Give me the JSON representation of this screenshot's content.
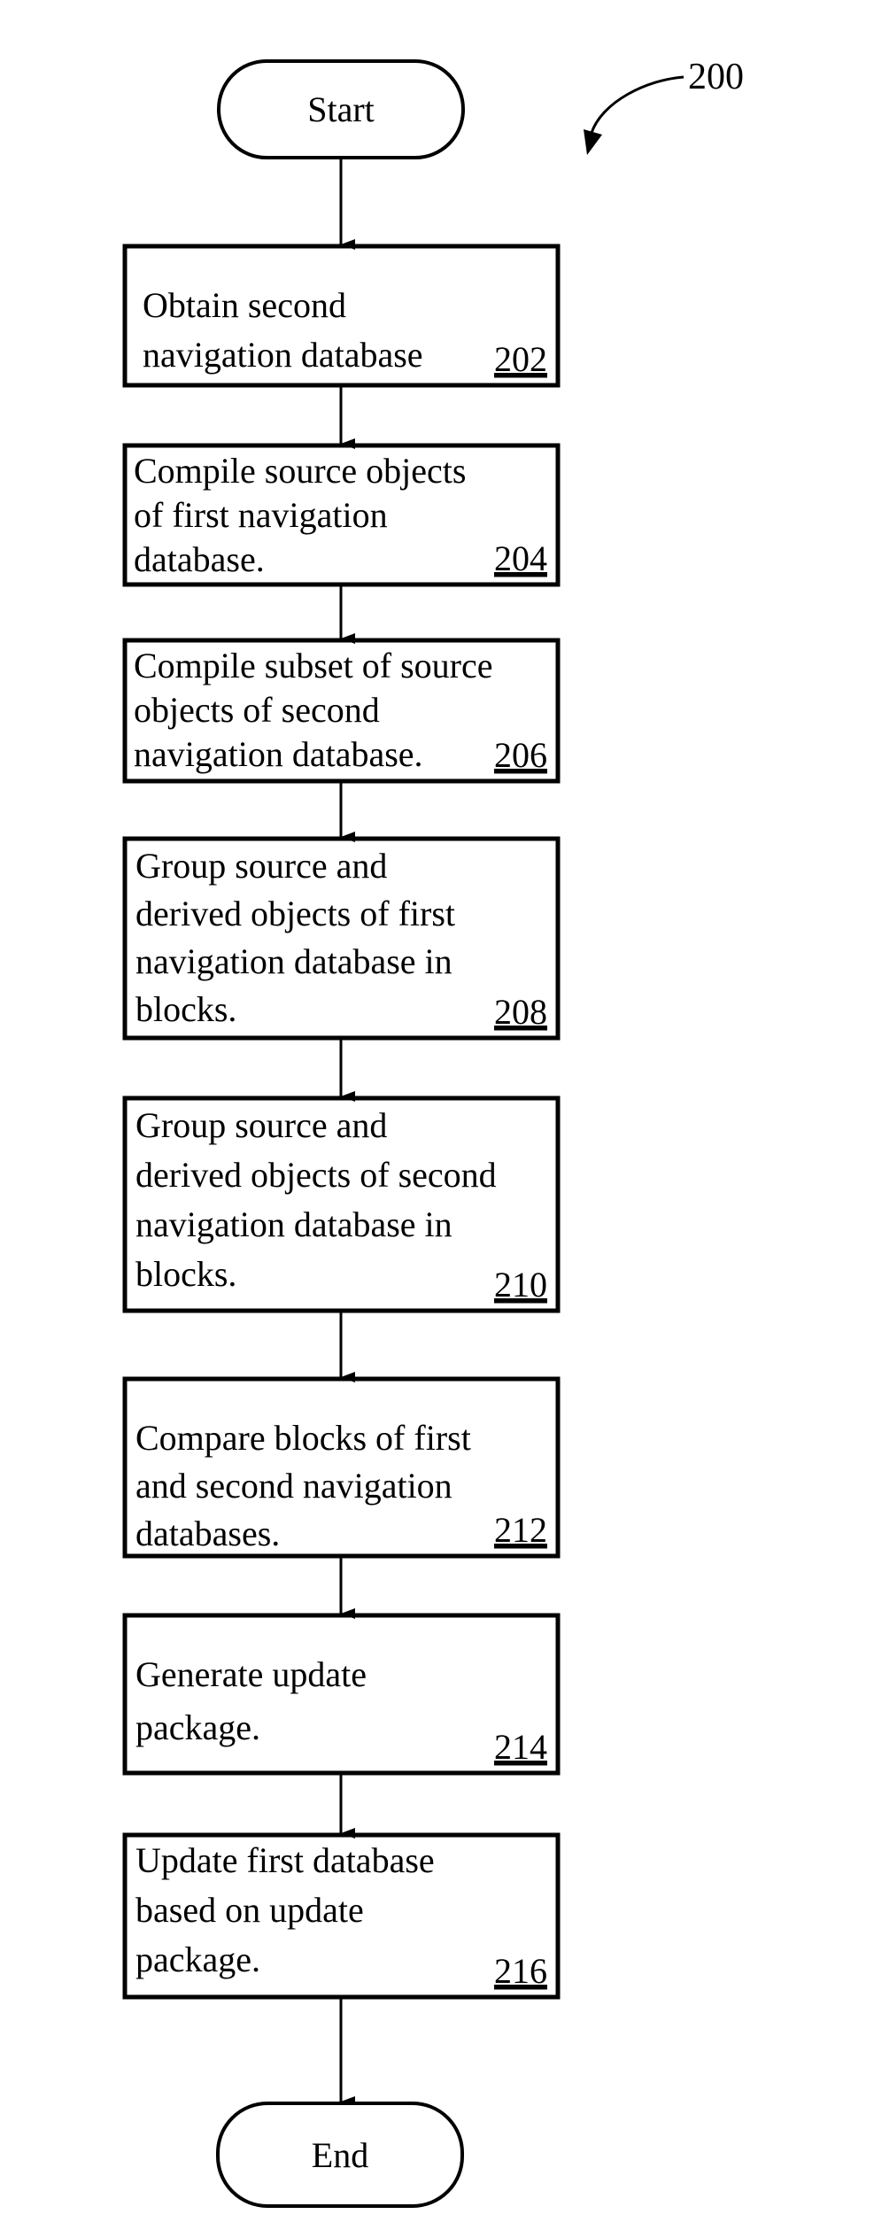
{
  "figure": {
    "reference_label": "200",
    "start": {
      "label": "Start"
    },
    "end": {
      "label": "End"
    },
    "steps": [
      {
        "id": "202",
        "lines": [
          "Obtain second",
          "navigation database"
        ],
        "ref": "202"
      },
      {
        "id": "204",
        "lines": [
          "Compile source objects",
          "of first navigation",
          "database."
        ],
        "ref": "204"
      },
      {
        "id": "206",
        "lines": [
          "Compile subset of source",
          "objects of second",
          "navigation database."
        ],
        "ref": "206"
      },
      {
        "id": "208",
        "lines": [
          "Group source and",
          "derived objects of first",
          "navigation database in",
          "blocks."
        ],
        "ref": "208"
      },
      {
        "id": "210",
        "lines": [
          "Group source and",
          "derived objects of second",
          "navigation database in",
          "blocks."
        ],
        "ref": "210"
      },
      {
        "id": "212",
        "lines": [
          "Compare blocks of first",
          "and second navigation",
          "databases."
        ],
        "ref": "212"
      },
      {
        "id": "214",
        "lines": [
          "Generate update",
          "package."
        ],
        "ref": "214"
      },
      {
        "id": "216",
        "lines": [
          "Update first database",
          "based on update",
          "package."
        ],
        "ref": "216"
      }
    ],
    "colors": {
      "stroke": "#000000",
      "background": "#ffffff"
    }
  }
}
